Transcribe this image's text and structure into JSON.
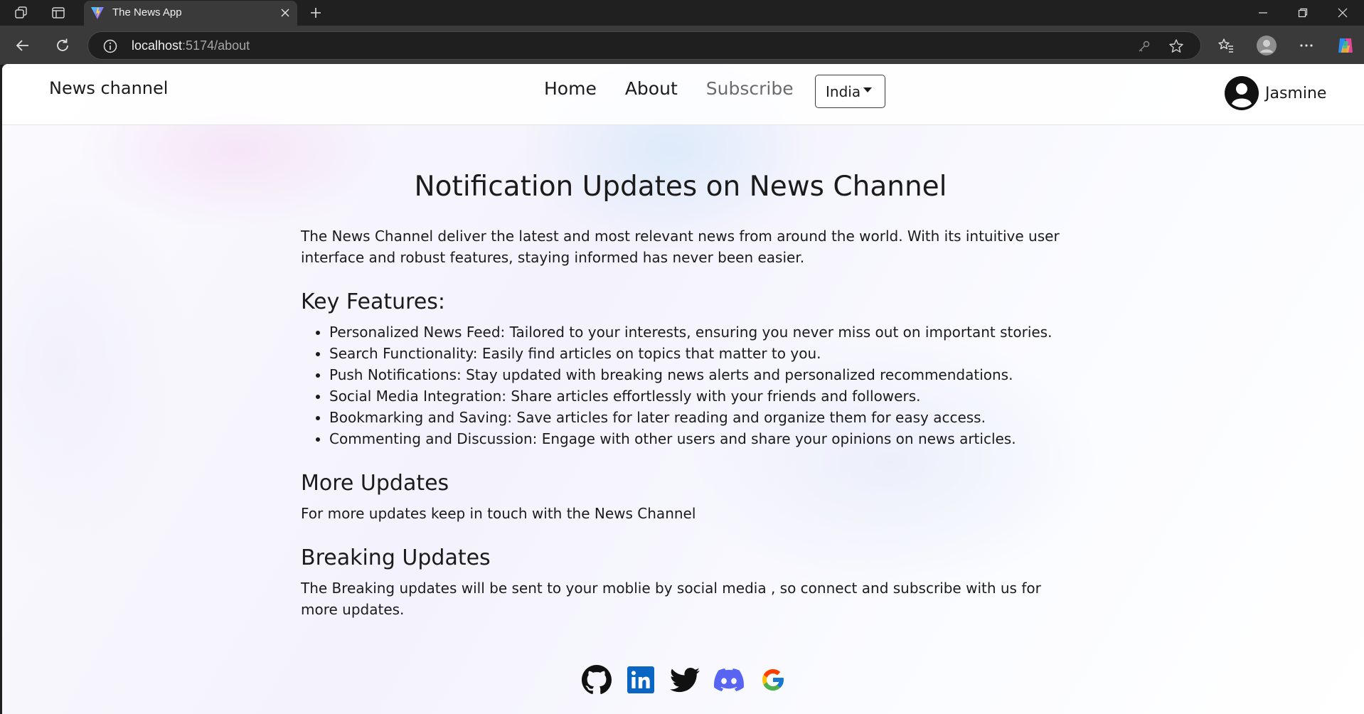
{
  "browser": {
    "tab_title": "The News App",
    "url_host": "localhost",
    "url_path": ":5174/about"
  },
  "site": {
    "brand": "News channel",
    "nav": [
      {
        "label": "Home"
      },
      {
        "label": "About"
      },
      {
        "label": "Subscribe"
      }
    ],
    "country": "India",
    "user_name": "Jasmine"
  },
  "page": {
    "title": "Notification Updates on News Channel",
    "intro": "The News Channel deliver the latest and most relevant news from around the world. With its intuitive user interface and robust features, staying informed has never been easier.",
    "features_heading": "Key Features:",
    "features": [
      "Personalized News Feed: Tailored to your interests, ensuring you never miss out on important stories.",
      "Search Functionality: Easily find articles on topics that matter to you.",
      "Push Notifications: Stay updated with breaking news alerts and personalized recommendations.",
      "Social Media Integration: Share articles effortlessly with your friends and followers.",
      "Bookmarking and Saving: Save articles for later reading and organize them for easy access.",
      "Commenting and Discussion: Engage with other users and share your opinions on news articles."
    ],
    "more_heading": "More Updates",
    "more_text": "For more updates keep in touch with the News Channel",
    "breaking_heading": "Breaking Updates",
    "breaking_text": "The Breaking updates will be sent to your moblie by social media , so connect and subscribe with us for more updates."
  },
  "socials": [
    "github-icon",
    "linkedin-icon",
    "twitter-icon",
    "discord-icon",
    "google-icon"
  ]
}
